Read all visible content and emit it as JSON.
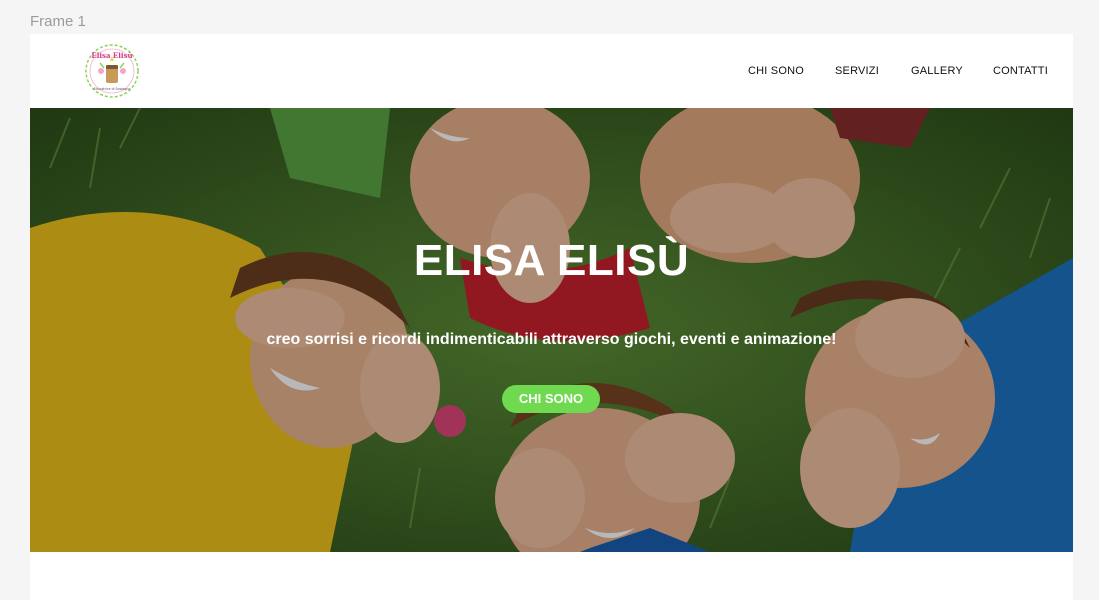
{
  "canvas": {
    "frame_label": "Frame 1"
  },
  "header": {
    "logo": {
      "text_top": "Elisa Elisù",
      "text_bottom": "Educatrice di Sostegno"
    },
    "nav": [
      {
        "label": "CHI SONO"
      },
      {
        "label": "SERVIZI"
      },
      {
        "label": "GALLERY"
      },
      {
        "label": "CONTATTI"
      }
    ]
  },
  "hero": {
    "title": "ELISA ELISÙ",
    "subtitle": "creo sorrisi e ricordi indimenticabili attraverso giochi, eventi e animazione!",
    "cta_label": "CHI SONO",
    "background_icon": "children-photo",
    "colors": {
      "cta": "#6fd94f",
      "grass": "#3d6b24"
    }
  }
}
